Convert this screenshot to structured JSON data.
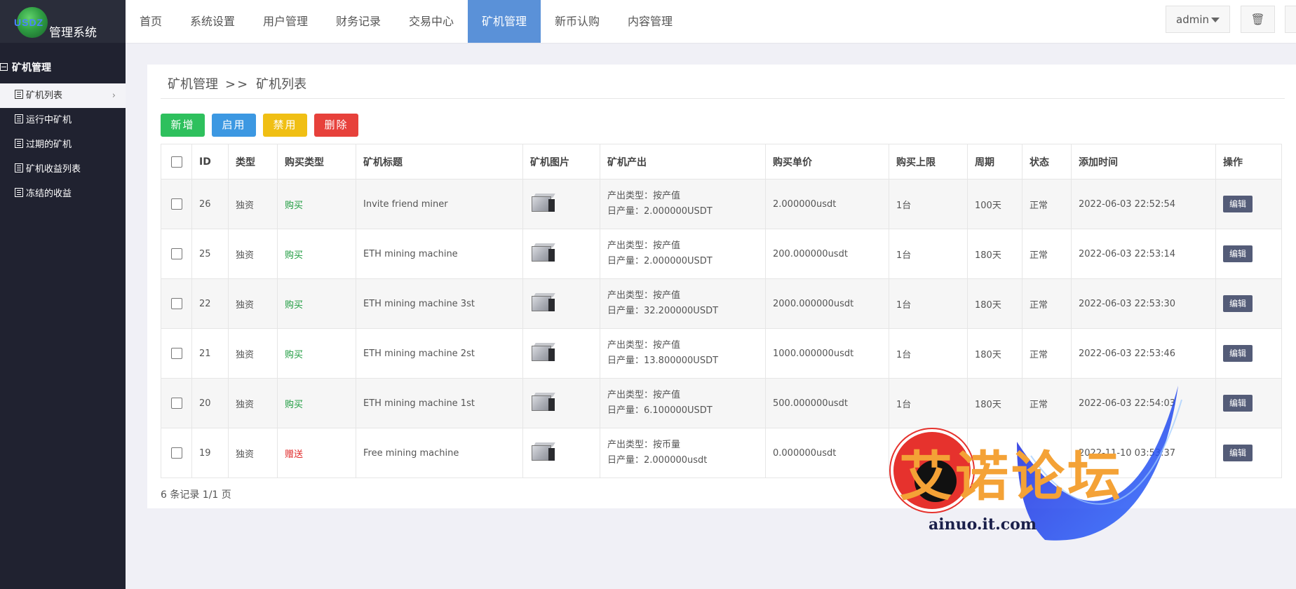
{
  "logo": {
    "badge": "USDZ",
    "title": "管理系统"
  },
  "sidebar": {
    "section": "矿机管理",
    "items": [
      {
        "label": "矿机列表",
        "active": true
      },
      {
        "label": "运行中矿机"
      },
      {
        "label": "过期的矿机"
      },
      {
        "label": "矿机收益列表"
      },
      {
        "label": "冻结的收益"
      }
    ]
  },
  "nav": {
    "items": [
      "首页",
      "系统设置",
      "用户管理",
      "财务记录",
      "交易中心",
      "矿机管理",
      "新币认购",
      "内容管理"
    ],
    "active": "矿机管理",
    "user": "admin"
  },
  "breadcrumb": {
    "parent": "矿机管理",
    "sep": ">>",
    "current": "矿机列表"
  },
  "buttons": {
    "add": "新增",
    "enable": "启用",
    "disable": "禁用",
    "delete": "删除"
  },
  "colors": {
    "add": "#2ec05d",
    "enable": "#3c98e2",
    "disable": "#f0bf14",
    "delete": "#e7413b",
    "nav_active": "#5a91d8"
  },
  "table": {
    "headers": [
      "ID",
      "类型",
      "购买类型",
      "矿机标题",
      "矿机图片",
      "矿机产出",
      "购买单价",
      "购买上限",
      "周期",
      "状态",
      "添加时间",
      "操作"
    ],
    "rows": [
      {
        "id": "26",
        "type": "独资",
        "buy": "购买",
        "title": "Invite friend miner",
        "out1": "产出类型：按产值",
        "out2": "日产量：2.000000USDT",
        "price": "2.000000usdt",
        "limit": "1台",
        "period": "100天",
        "status": "正常",
        "time": "2022-06-03 22:52:54",
        "op": "编辑"
      },
      {
        "id": "25",
        "type": "独资",
        "buy": "购买",
        "title": "ETH mining machine",
        "out1": "产出类型：按产值",
        "out2": "日产量：2.000000USDT",
        "price": "200.000000usdt",
        "limit": "1台",
        "period": "180天",
        "status": "正常",
        "time": "2022-06-03 22:53:14",
        "op": "编辑"
      },
      {
        "id": "22",
        "type": "独资",
        "buy": "购买",
        "title": "ETH mining machine 3st",
        "out1": "产出类型：按产值",
        "out2": "日产量：32.200000USDT",
        "price": "2000.000000usdt",
        "limit": "1台",
        "period": "180天",
        "status": "正常",
        "time": "2022-06-03 22:53:30",
        "op": "编辑"
      },
      {
        "id": "21",
        "type": "独资",
        "buy": "购买",
        "title": "ETH mining machine 2st",
        "out1": "产出类型：按产值",
        "out2": "日产量：13.800000USDT",
        "price": "1000.000000usdt",
        "limit": "1台",
        "period": "180天",
        "status": "正常",
        "time": "2022-06-03 22:53:46",
        "op": "编辑"
      },
      {
        "id": "20",
        "type": "独资",
        "buy": "购买",
        "title": "ETH mining machine 1st",
        "out1": "产出类型：按产值",
        "out2": "日产量：6.100000USDT",
        "price": "500.000000usdt",
        "limit": "1台",
        "period": "180天",
        "status": "正常",
        "time": "2022-06-03 22:54:03",
        "op": "编辑"
      },
      {
        "id": "19",
        "type": "独资",
        "buy": "赠送",
        "title": "Free mining machine",
        "out1": "产出类型：按币量",
        "out2": "日产量：2.000000usdt",
        "price": "0.000000usdt",
        "limit": "",
        "period": "",
        "status": "",
        "time": "2022-11-10 03:53:37",
        "op": "编辑"
      }
    ]
  },
  "footer": {
    "count": "6 条记录 1/1 页"
  },
  "watermark": {
    "text": "艾诺论坛",
    "url": "ainuo.it.com"
  }
}
